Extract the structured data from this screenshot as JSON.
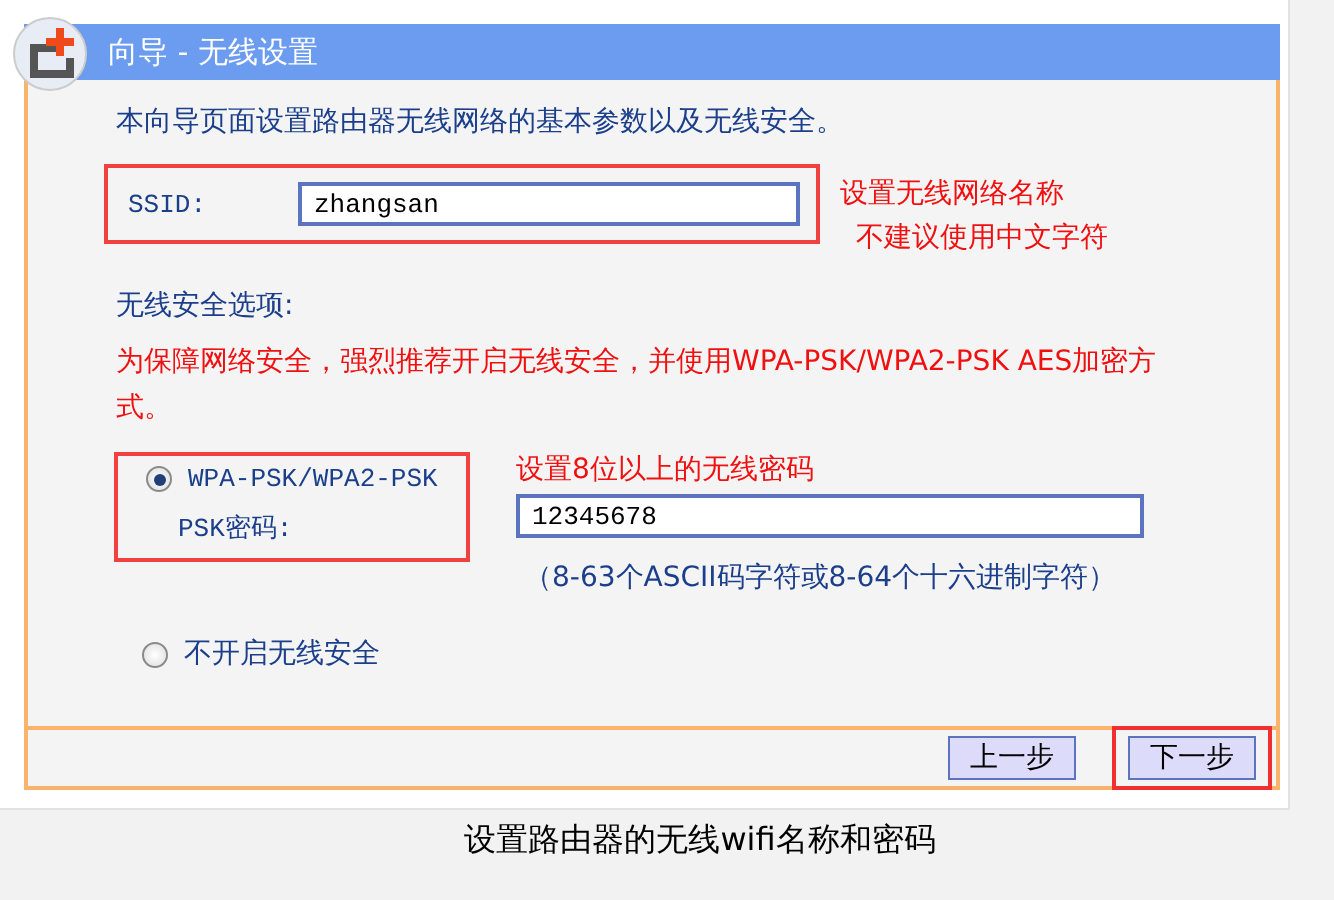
{
  "window": {
    "title": "向导 - 无线设置"
  },
  "intro": "本向导页面设置路由器无线网络的基本参数以及无线安全。",
  "ssid": {
    "label": "SSID:",
    "value": "zhangsan"
  },
  "ssid_notes": [
    "设置无线网络名称",
    "不建议使用中文字符"
  ],
  "security": {
    "heading": "无线安全选项:",
    "warning": "为保障网络安全，强烈推荐开启无线安全，并使用WPA-PSK/WPA2-PSK AES加密方式。",
    "options": [
      {
        "label": "WPA-PSK/WPA2-PSK",
        "selected": true
      },
      {
        "label": "不开启无线安全",
        "selected": false
      }
    ],
    "psk": {
      "label": "PSK密码:",
      "value": "12345678",
      "note": "设置8位以上的无线密码",
      "hint": "（8-63个ASCII码字符或8-64个十六进制字符）"
    }
  },
  "buttons": [
    {
      "label": "上一步",
      "highlighted": false
    },
    {
      "label": "下一步",
      "highlighted": true
    }
  ],
  "caption": "设置路由器的无线wifi名称和密码"
}
